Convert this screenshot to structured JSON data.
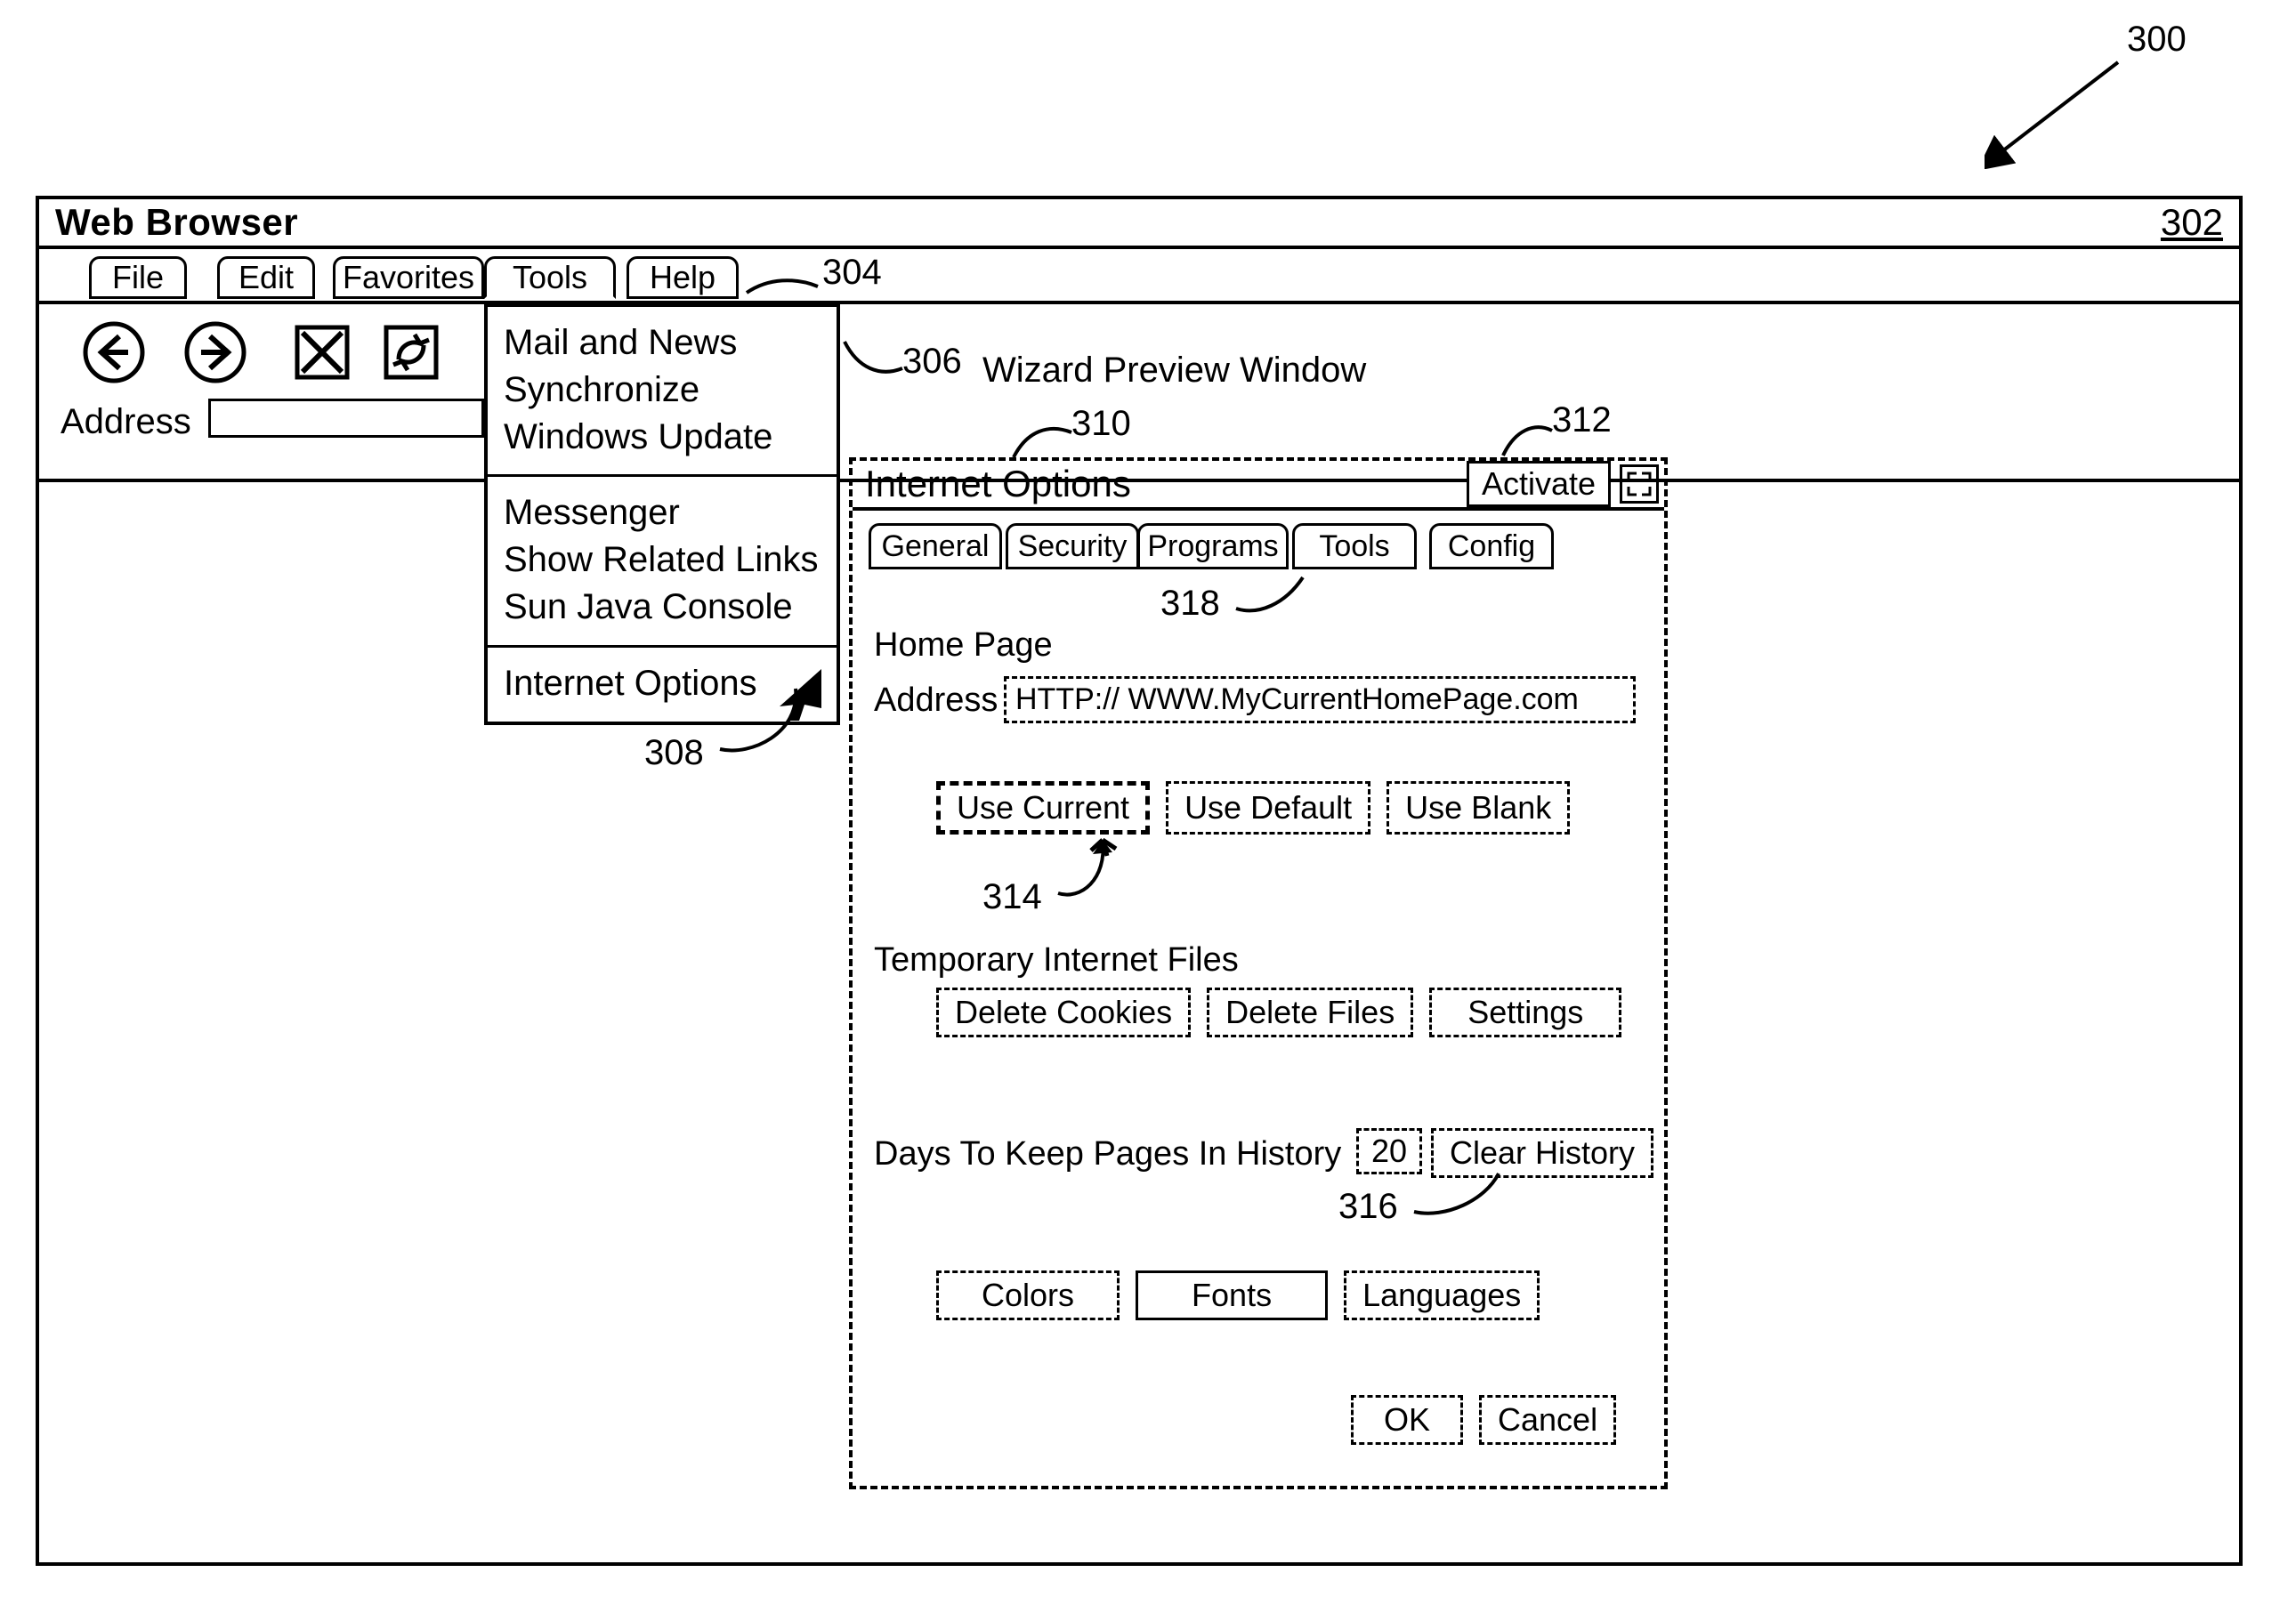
{
  "figure": {
    "n300": "300",
    "n302": "302",
    "n304": "304",
    "n306": "306",
    "n308": "308",
    "n310": "310",
    "n312": "312",
    "n314": "314",
    "n316": "316",
    "n318": "318"
  },
  "window": {
    "title": "Web Browser"
  },
  "menu": {
    "file": "File",
    "edit": "Edit",
    "favorites": "Favorites",
    "tools": "Tools",
    "help": "Help"
  },
  "tools_menu": {
    "sec1": {
      "a": "Mail and News",
      "b": "Synchronize",
      "c": "Windows Update"
    },
    "sec2": {
      "a": "Messenger",
      "b": "Show Related Links",
      "c": "Sun Java Console"
    },
    "sec3": {
      "a": "Internet Options"
    }
  },
  "address": {
    "label": "Address",
    "value": ""
  },
  "preview": {
    "heading": "Wizard Preview Window"
  },
  "internet_options": {
    "title": "Internet Options",
    "activate": "Activate",
    "tabs": {
      "general": "General",
      "security": "Security",
      "programs": "Programs",
      "tools": "Tools",
      "config": "Config"
    },
    "homepage": {
      "section": "Home Page",
      "address_label": "Address",
      "address_value": "HTTP:// WWW.MyCurrentHomePage.com",
      "use_current": "Use Current",
      "use_default": "Use Default",
      "use_blank": "Use Blank"
    },
    "temp": {
      "section": "Temporary Internet Files",
      "delete_cookies": "Delete Cookies",
      "delete_files": "Delete Files",
      "settings": "Settings"
    },
    "history": {
      "section": "Days To Keep Pages In History",
      "days": "20",
      "clear": "Clear History"
    },
    "footer": {
      "colors": "Colors",
      "fonts": "Fonts",
      "languages": "Languages"
    },
    "ok": "OK",
    "cancel": "Cancel"
  }
}
